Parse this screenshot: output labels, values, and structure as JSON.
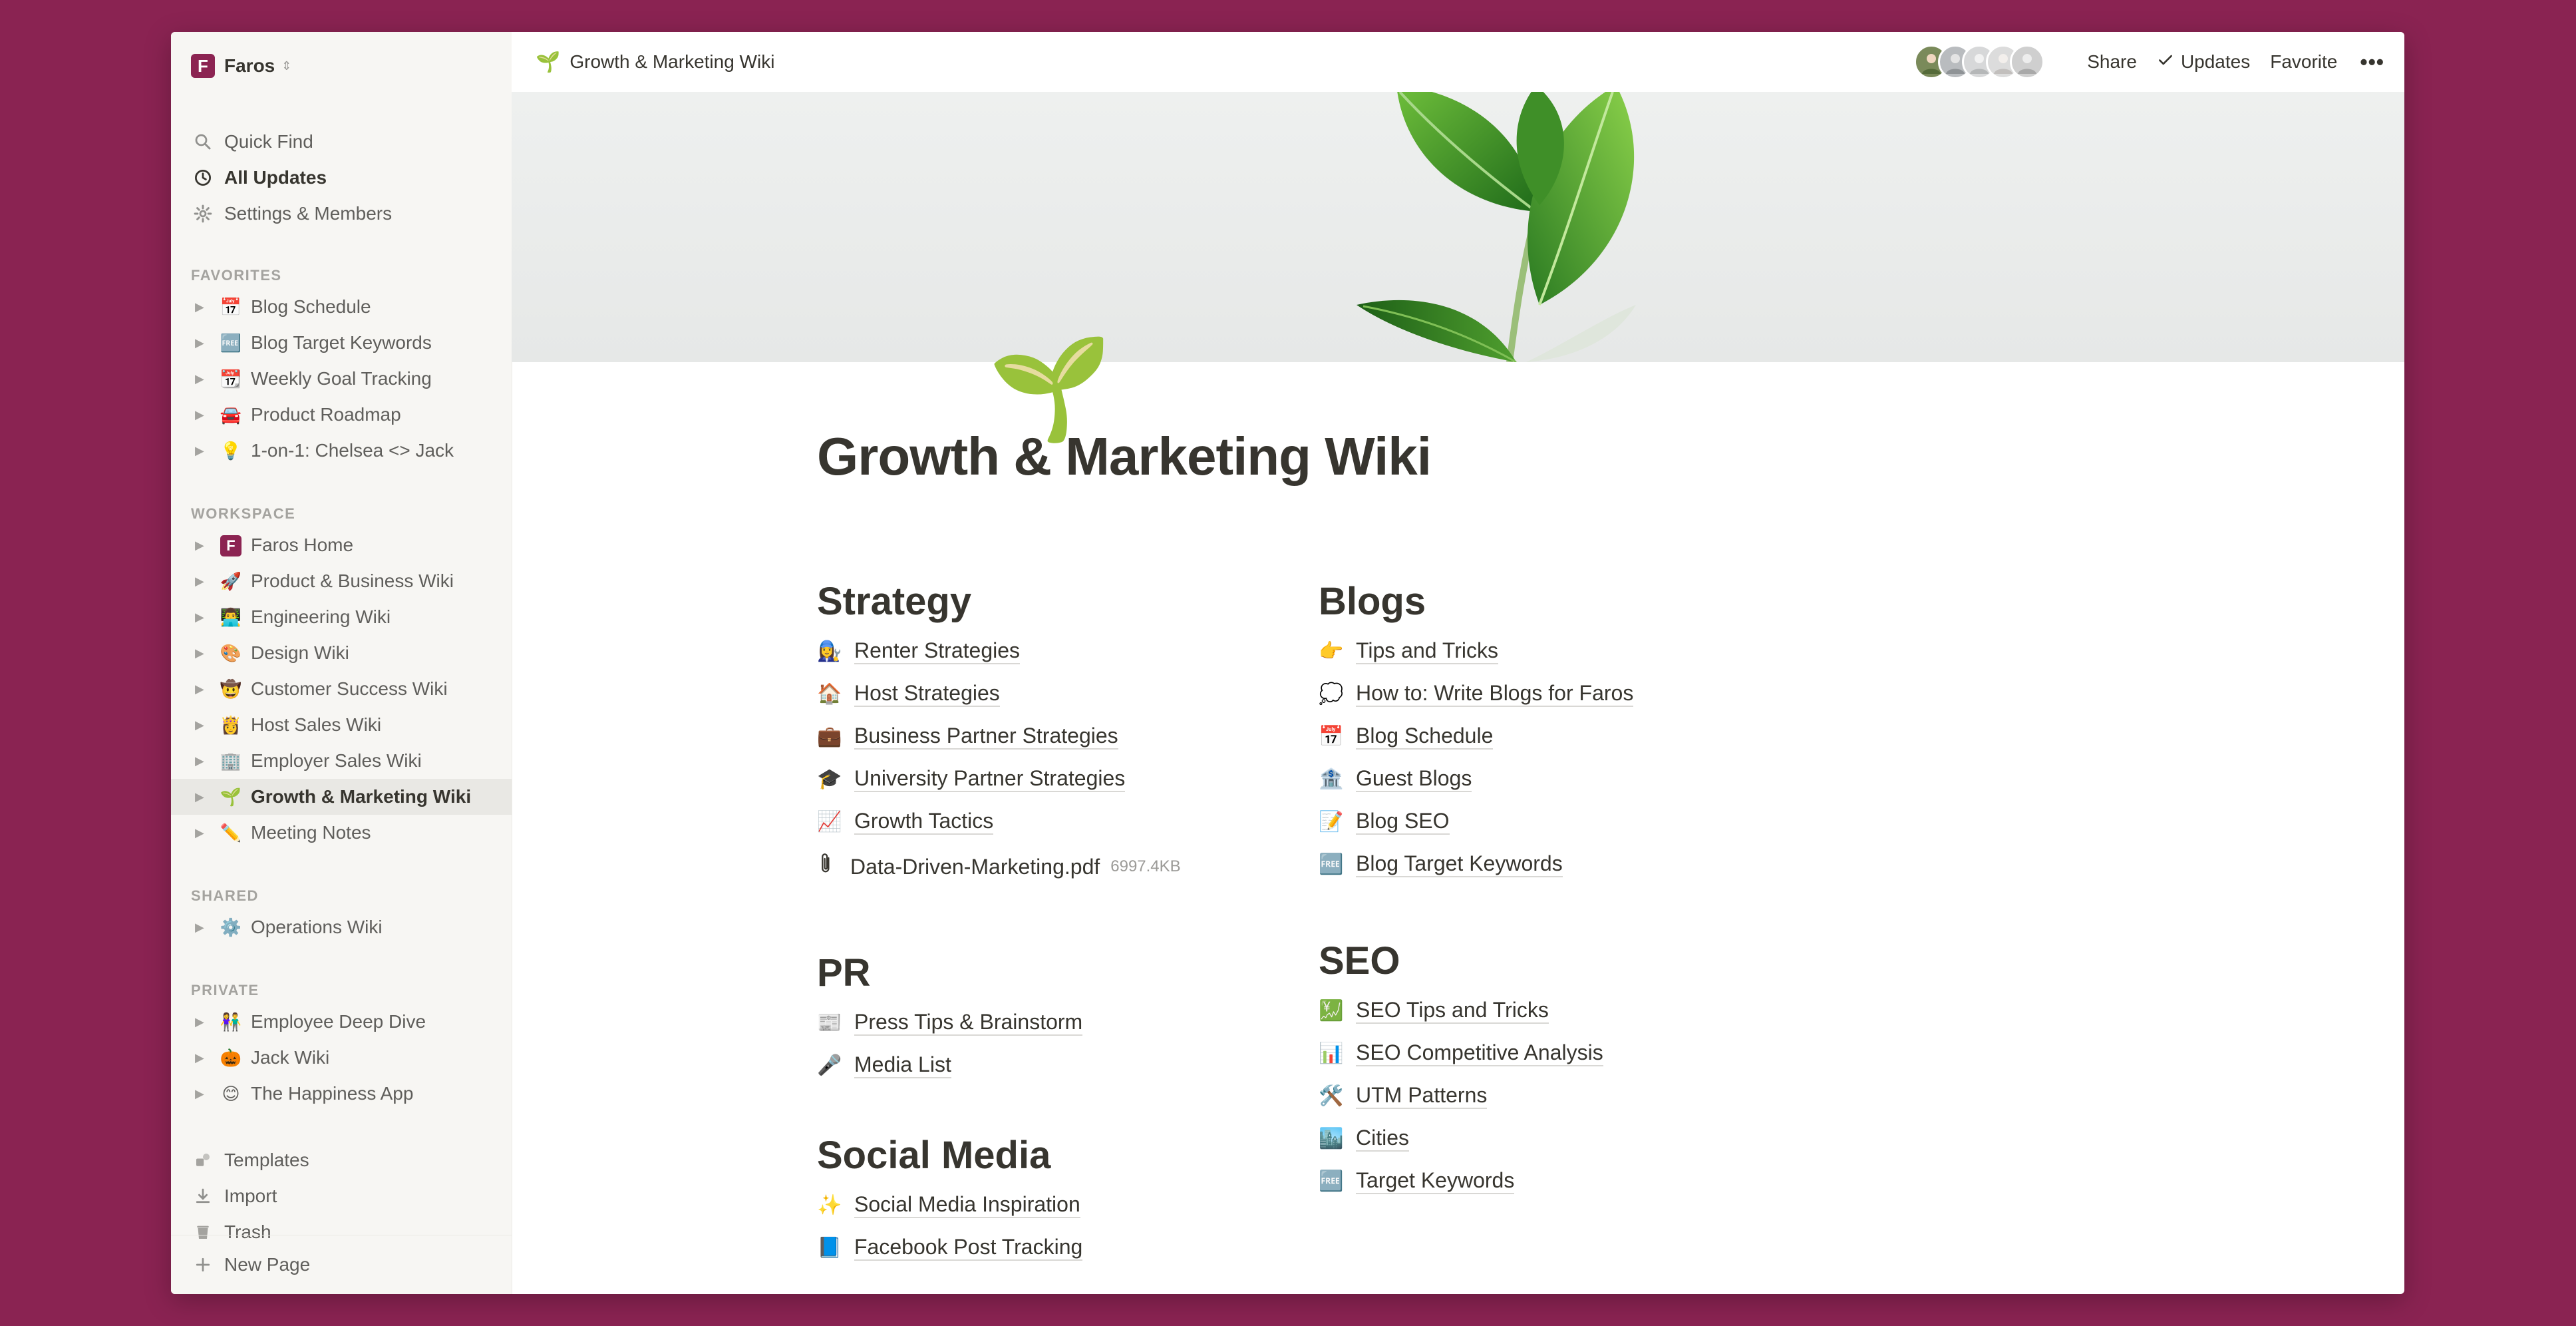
{
  "workspace": {
    "name": "Faros",
    "logo_letter": "F"
  },
  "sidebar": {
    "top": [
      {
        "label": "Quick Find",
        "icon": "search-icon"
      },
      {
        "label": "All Updates",
        "icon": "clock-icon",
        "active": true
      },
      {
        "label": "Settings & Members",
        "icon": "gear-icon"
      }
    ],
    "favorites_heading": "FAVORITES",
    "favorites": [
      {
        "emoji": "📅",
        "label": "Blog Schedule"
      },
      {
        "emoji": "🆓",
        "label": "Blog Target Keywords"
      },
      {
        "emoji": "📆",
        "label": "Weekly Goal Tracking"
      },
      {
        "emoji": "🚘",
        "label": "Product Roadmap"
      },
      {
        "emoji": "💡",
        "label": "1-on-1: Chelsea <> Jack"
      }
    ],
    "workspace_heading": "WORKSPACE",
    "workspace_items": [
      {
        "emoji": "F",
        "label": "Faros Home"
      },
      {
        "emoji": "🚀",
        "label": "Product & Business Wiki"
      },
      {
        "emoji": "👨‍💻",
        "label": "Engineering Wiki"
      },
      {
        "emoji": "🎨",
        "label": "Design Wiki"
      },
      {
        "emoji": "🤠",
        "label": "Customer Success Wiki"
      },
      {
        "emoji": "👸",
        "label": "Host Sales Wiki"
      },
      {
        "emoji": "🏢",
        "label": "Employer Sales Wiki"
      },
      {
        "emoji": "🌱",
        "label": "Growth & Marketing Wiki",
        "selected": true
      },
      {
        "emoji": "✏️",
        "label": "Meeting Notes"
      }
    ],
    "shared_heading": "SHARED",
    "shared_items": [
      {
        "emoji": "⚙️",
        "label": "Operations Wiki"
      }
    ],
    "private_heading": "PRIVATE",
    "private_items": [
      {
        "emoji": "👫",
        "label": "Employee Deep Dive"
      },
      {
        "emoji": "🎃",
        "label": "Jack Wiki"
      },
      {
        "emoji": "😊",
        "label": "The Happiness App"
      }
    ],
    "bottom": [
      {
        "label": "Templates",
        "icon": "templates-icon"
      },
      {
        "label": "Import",
        "icon": "import-icon"
      },
      {
        "label": "Trash",
        "icon": "trash-icon"
      }
    ],
    "new_page": "New Page"
  },
  "topbar": {
    "breadcrumb_emoji": "🌱",
    "breadcrumb": "Growth & Marketing Wiki",
    "share": "Share",
    "updates": "Updates",
    "favorite": "Favorite",
    "more": "•••"
  },
  "page": {
    "icon": "🌱",
    "title": "Growth & Marketing Wiki",
    "strategy": {
      "heading": "Strategy",
      "links": [
        {
          "emoji": "👩‍🔧",
          "label": "Renter Strategies"
        },
        {
          "emoji": "🏠",
          "label": "Host Strategies"
        },
        {
          "emoji": "💼",
          "label": "Business Partner Strategies"
        },
        {
          "emoji": "🎓",
          "label": "University Partner Strategies"
        },
        {
          "emoji": "📈",
          "label": "Growth Tactics"
        }
      ],
      "file": {
        "name": "Data-Driven-Marketing.pdf",
        "size": "6997.4KB"
      }
    },
    "pr": {
      "heading": "PR",
      "links": [
        {
          "emoji": "📰",
          "label": "Press Tips & Brainstorm"
        },
        {
          "emoji": "🎤",
          "label": "Media List"
        }
      ]
    },
    "social": {
      "heading": "Social Media",
      "links": [
        {
          "emoji": "✨",
          "label": "Social Media Inspiration"
        },
        {
          "emoji": "📘",
          "label": "Facebook Post Tracking"
        }
      ]
    },
    "blogs": {
      "heading": "Blogs",
      "links": [
        {
          "emoji": "👉",
          "label": "Tips and Tricks"
        },
        {
          "emoji": "💭",
          "label": "How to: Write Blogs for Faros"
        },
        {
          "emoji": "📅",
          "label": "Blog Schedule"
        },
        {
          "emoji": "🏦",
          "label": "Guest Blogs"
        },
        {
          "emoji": "📝",
          "label": "Blog SEO"
        },
        {
          "emoji": "🆓",
          "label": "Blog Target Keywords"
        }
      ]
    },
    "seo": {
      "heading": "SEO",
      "links": [
        {
          "emoji": "💹",
          "label": "SEO Tips and Tricks"
        },
        {
          "emoji": "📊",
          "label": "SEO Competitive Analysis"
        },
        {
          "emoji": "🛠️",
          "label": "UTM Patterns"
        },
        {
          "emoji": "🏙️",
          "label": "Cities"
        },
        {
          "emoji": "🆓",
          "label": "Target Keywords"
        }
      ]
    }
  },
  "colors": {
    "background": "#8a2352",
    "brand": "#8c2452",
    "sidebar": "#f7f6f3",
    "text": "#37352f"
  }
}
